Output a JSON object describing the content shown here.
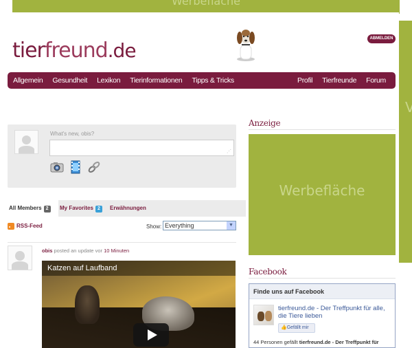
{
  "ads": {
    "label": "Werbefläche",
    "right_letter": "V"
  },
  "header": {
    "logo_part1": "tier",
    "logo_part2": "freund",
    "logo_tld": ".de",
    "logout_label": "ABMELDEN"
  },
  "nav": {
    "left": [
      "Allgemein",
      "Gesundheit",
      "Lexikon",
      "Tierinformationen",
      "Tipps & Tricks"
    ],
    "right": [
      "Profil",
      "Tierfreunde",
      "Forum"
    ]
  },
  "activity_form": {
    "placeholder": "What's new, obis?"
  },
  "tabs": {
    "all_members": "All Members",
    "all_members_count": "2",
    "favorites": "My Favorites",
    "favorites_count": "2",
    "mentions": "Erwähnungen"
  },
  "feed": {
    "rss_label": "RSS-Feed",
    "show_label": "Show:",
    "show_value": "Everything"
  },
  "activity_item": {
    "user": "obis",
    "action": "posted an update",
    "time_prefix": "vor",
    "time": "10 Minuten",
    "video_title": "Katzen auf Laufband"
  },
  "sidebar": {
    "ad_heading": "Anzeige",
    "ad_label": "Werbefläche",
    "facebook_heading": "Facebook",
    "fb_box_title": "Finde uns auf Facebook",
    "fb_page_name": "tierfreund.de - Der Treffpunkt für alle, die Tiere lieben",
    "fb_like_label": "Gefällt mir",
    "fb_count_prefix": "44 Personen gefällt",
    "fb_count_page": "tierfreund.de - Der Treffpunkt für"
  },
  "colors": {
    "brand": "#7a1c3e",
    "ad_green": "#a1b33f",
    "facebook_blue": "#3b5998"
  }
}
